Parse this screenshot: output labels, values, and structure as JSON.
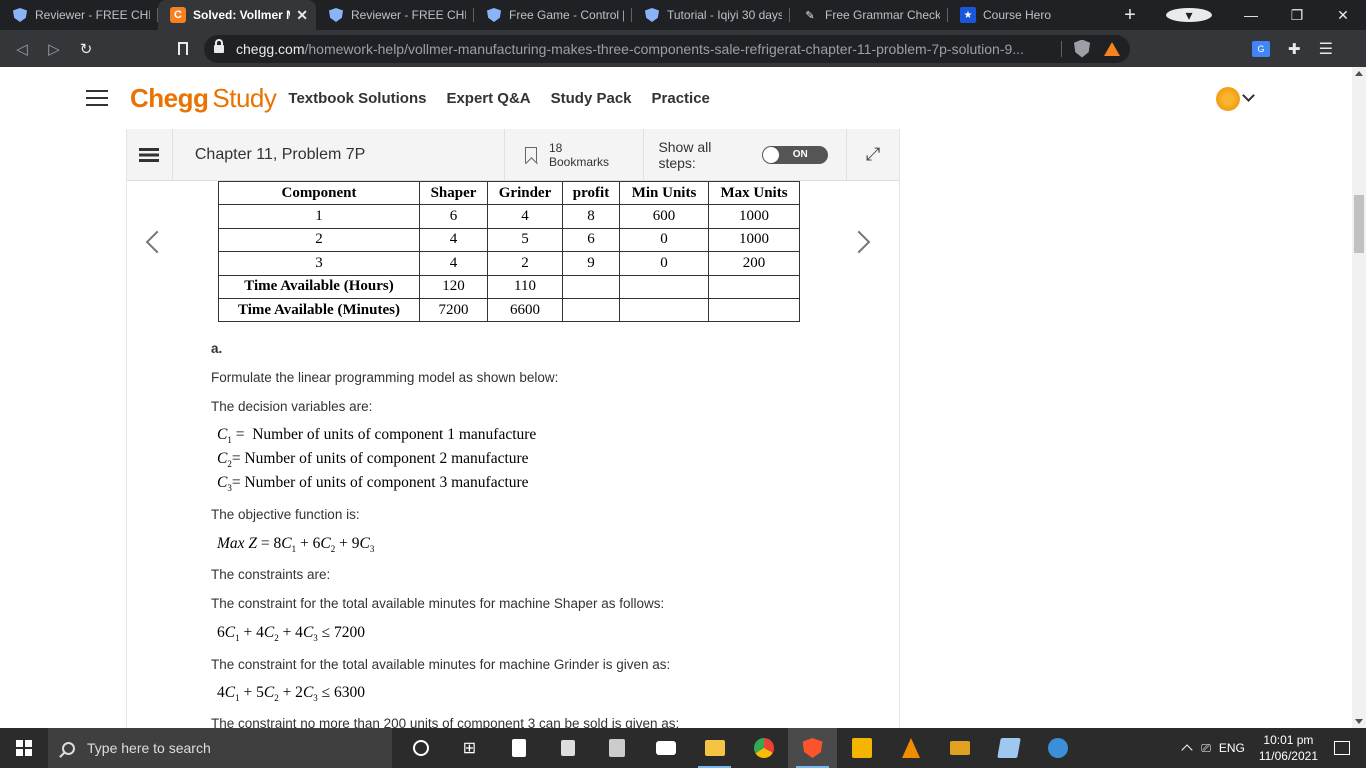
{
  "browser": {
    "tabs": [
      {
        "title": "Reviewer - FREE CHEGG",
        "icon": "brave-shield-icon",
        "active": false
      },
      {
        "title": "Solved: Vollmer Ma",
        "icon": "chegg-icon",
        "active": true
      },
      {
        "title": "Reviewer - FREE CHEGG",
        "icon": "brave-shield-icon",
        "active": false
      },
      {
        "title": "Free Game - Control [E",
        "icon": "brave-shield-icon",
        "active": false
      },
      {
        "title": "Tutorial - Iqiyi 30 days",
        "icon": "brave-shield-icon",
        "active": false
      },
      {
        "title": "Free Grammar Check |",
        "icon": "pen-icon",
        "active": false
      },
      {
        "title": "Course Hero",
        "icon": "star-icon",
        "active": false
      }
    ],
    "url_host": "chegg.com",
    "url_path": "/homework-help/vollmer-manufacturing-makes-three-components-sale-refrigerat-chapter-11-problem-7p-solution-9...",
    "shield_count": "1"
  },
  "chegg": {
    "logo_chegg": "Chegg",
    "logo_study": "Study",
    "nav": [
      "Textbook Solutions",
      "Expert Q&A",
      "Study Pack",
      "Practice"
    ]
  },
  "panel": {
    "chapter": "Chapter 11, Problem 7P",
    "bookmarks": "18 Bookmarks",
    "show_steps_label": "Show all steps:",
    "toggle_state": "ON"
  },
  "table": {
    "headers": [
      "Component",
      "Shaper",
      "Grinder",
      "profit",
      "Min Units",
      "Max Units"
    ],
    "rows": [
      [
        "1",
        "6",
        "4",
        "8",
        "600",
        "1000"
      ],
      [
        "2",
        "4",
        "5",
        "6",
        "0",
        "1000"
      ],
      [
        "3",
        "4",
        "2",
        "9",
        "0",
        "200"
      ],
      [
        "Time Available (Hours)",
        "120",
        "110",
        "",
        "",
        ""
      ],
      [
        "Time Available (Minutes)",
        "7200",
        "6600",
        "",
        "",
        ""
      ]
    ]
  },
  "solution": {
    "part": "a.",
    "formulate": "Formulate the linear programming model as shown below:",
    "decision_intro": "The decision variables are:",
    "var1_text": "Number of units of component 1 manufacture",
    "var2_text": "Number of units of component 2 manufacture",
    "var3_text": "Number of units of component 3 manufacture",
    "objective_intro": "The objective function is:",
    "constraints_intro": "The constraints are:",
    "shaper_intro": "The constraint for the total available minutes for machine Shaper as follows:",
    "grinder_intro": "The constraint for the total available minutes for machine Grinder is given as:",
    "last_line": "The constraint no more than 200 units of component 3 can be sold is given as:"
  },
  "taskbar": {
    "search_placeholder": "Type here to search",
    "language": "ENG",
    "time": "10:01 pm",
    "date": "11/06/2021"
  },
  "colors": {
    "chegg_orange": "#eb7100",
    "browser_dark": "#202124",
    "taskbar": "#2b2b2b"
  }
}
